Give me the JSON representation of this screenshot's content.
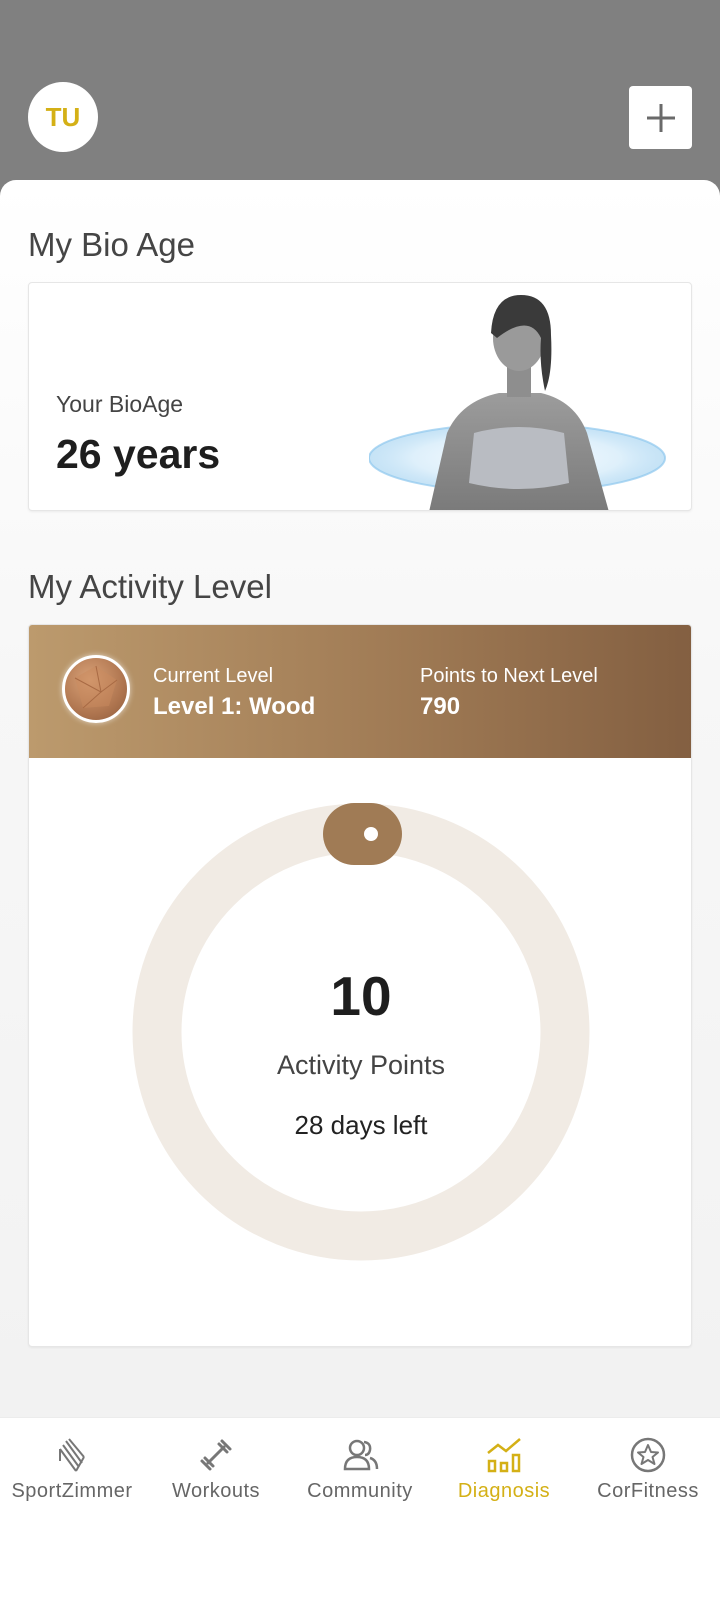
{
  "header": {
    "avatar_initials": "TU",
    "accent_color": "#d4b016"
  },
  "bio_age": {
    "title": "My Bio Age",
    "label": "Your BioAge",
    "value": "26 years"
  },
  "activity": {
    "title": "My Activity Level",
    "current_level_caption": "Current Level",
    "current_level_value": "Level 1: Wood",
    "next_level_caption": "Points to Next Level",
    "next_level_points": "790",
    "points": "10",
    "points_label": "Activity Points",
    "days_left": "28 days left",
    "level_color_start": "#bc9a6d",
    "level_color_end": "#835f41"
  },
  "nav": {
    "items": [
      {
        "label": "SportZimmer",
        "icon": "sportzimmer-icon",
        "active": false
      },
      {
        "label": "Workouts",
        "icon": "dumbbell-icon",
        "active": false
      },
      {
        "label": "Community",
        "icon": "community-icon",
        "active": false
      },
      {
        "label": "Diagnosis",
        "icon": "diagnosis-chart-icon",
        "active": true
      },
      {
        "label": "CorFitness",
        "icon": "star-circle-icon",
        "active": false
      }
    ],
    "active_color": "#d4b016",
    "inactive_color": "#666666"
  }
}
